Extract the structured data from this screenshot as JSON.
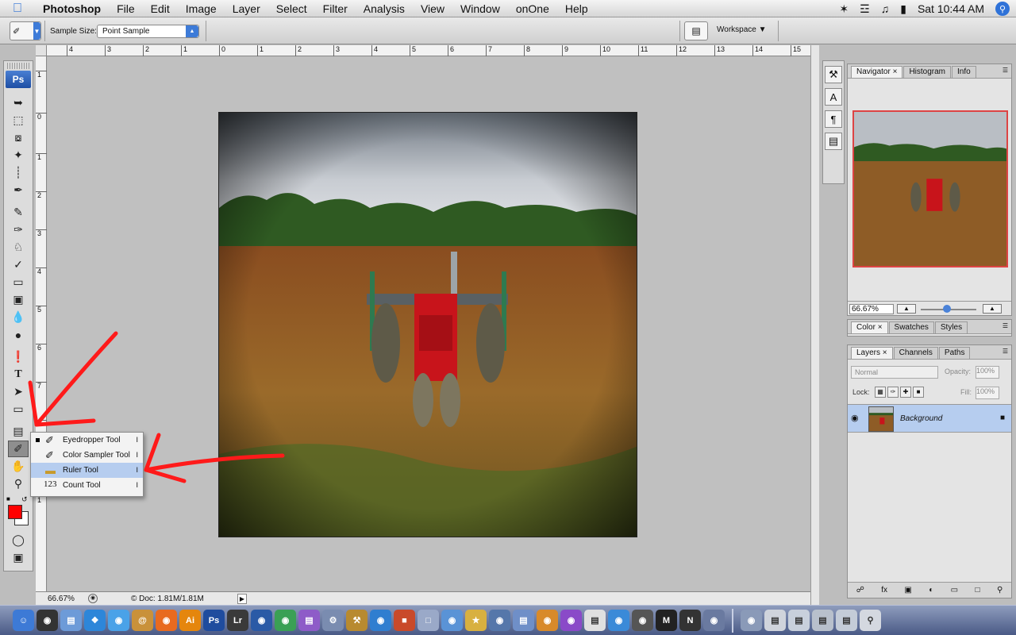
{
  "menubar": {
    "apple_icon": "apple-icon",
    "items": [
      "Photoshop",
      "File",
      "Edit",
      "Image",
      "Layer",
      "Select",
      "Filter",
      "Analysis",
      "View",
      "Window",
      "onOne",
      "Help"
    ],
    "clock": "Sat 10:44 AM"
  },
  "options": {
    "sample_size_label": "Sample Size:",
    "sample_size_value": "Point Sample",
    "workspace_label": "Workspace"
  },
  "toolbox": {
    "logo": "Ps",
    "tools": [
      "move-icon",
      "marquee-icon",
      "lasso-icon",
      "magic-wand-icon",
      "crop-icon",
      "slice-icon",
      "healing-brush-icon",
      "brush-icon",
      "clone-stamp-icon",
      "history-brush-icon",
      "eraser-icon",
      "gradient-icon",
      "blur-icon",
      "dodge-icon",
      "pen-icon",
      "type-icon",
      "path-selection-icon",
      "shape-icon",
      "notes-icon",
      "eyedropper-icon",
      "hand-icon",
      "zoom-icon"
    ],
    "foreground_color": "#ff0000",
    "background_color": "#ffffff"
  },
  "ruler": {
    "h_ticks": [
      "4",
      "3",
      "2",
      "1",
      "0",
      "1",
      "2",
      "3",
      "4",
      "5",
      "6",
      "7",
      "8",
      "9",
      "10",
      "11",
      "12",
      "13",
      "14",
      "15"
    ],
    "v_ticks": [
      "1",
      "0",
      "1",
      "2",
      "3",
      "4",
      "5",
      "6",
      "7",
      "8",
      "9",
      "1"
    ]
  },
  "flyout": {
    "items": [
      {
        "label": "Eyedropper Tool",
        "key": "I",
        "icon": "eyedropper-icon",
        "current": true
      },
      {
        "label": "Color Sampler Tool",
        "key": "I",
        "icon": "color-sampler-icon",
        "current": false
      },
      {
        "label": "Ruler Tool",
        "key": "I",
        "icon": "ruler-icon",
        "current": false
      },
      {
        "label": "Count Tool",
        "key": "I",
        "icon": "count-icon",
        "current": false
      }
    ],
    "count_glyph": "123"
  },
  "status": {
    "zoom": "66.67%",
    "doc": "© Doc: 1.81M/1.81M"
  },
  "navigator": {
    "tabs": [
      "Navigator",
      "Histogram",
      "Info"
    ],
    "zoom": "66.67%"
  },
  "color_panel": {
    "tabs": [
      "Color",
      "Swatches",
      "Styles"
    ]
  },
  "layers": {
    "tabs": [
      "Layers",
      "Channels",
      "Paths"
    ],
    "blend_mode": "Normal",
    "opacity_label": "Opacity:",
    "opacity_value": "100%",
    "lock_label": "Lock:",
    "fill_label": "Fill:",
    "fill_value": "100%",
    "layer_name": "Background"
  },
  "dock": {
    "apps": [
      "finder-icon",
      "dashboard-icon",
      "preview-icon",
      "safari-icon",
      "ichat-icon",
      "address-book-icon",
      "firefox-icon",
      "illustrator-icon",
      "photoshop-icon",
      "lightroom-icon",
      "iphoto-icon",
      "chrome-icon",
      "photo-icon",
      "utility-icon",
      "tool-icon",
      "app-icon"
    ],
    "labels": {
      "ai": "Ai",
      "ps": "Ps",
      "lr": "Lr"
    }
  }
}
